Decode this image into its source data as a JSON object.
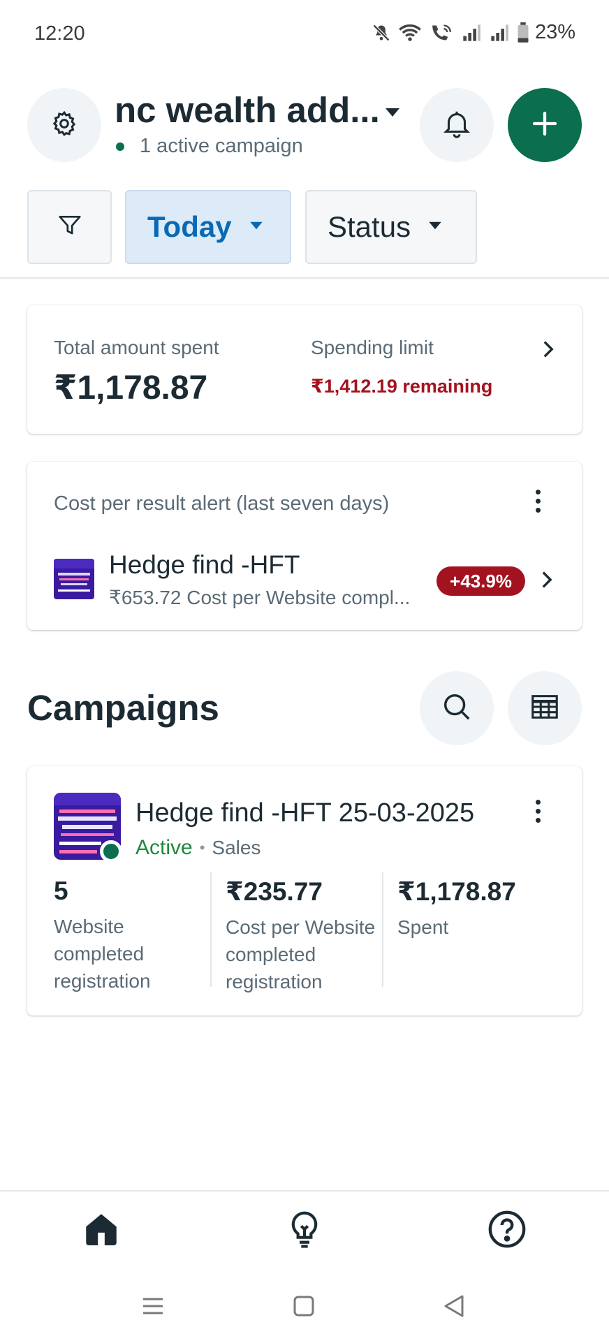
{
  "status_bar": {
    "time": "12:20",
    "battery": "23%",
    "icons": [
      "mute-icon",
      "wifi-icon",
      "wifi-call-icon",
      "signal-icon",
      "signal-icon",
      "battery-icon"
    ]
  },
  "header": {
    "account_name": "nc wealth add...",
    "active_campaigns": "1 active campaign",
    "icons": {
      "settings": "gear-icon",
      "notifications": "bell-icon",
      "create": "plus-icon"
    }
  },
  "filters": {
    "date_label": "Today",
    "status_label": "Status"
  },
  "spend_summary": {
    "total_label": "Total amount spent",
    "total_value": "₹1,178.87",
    "limit_label": "Spending limit",
    "limit_remaining": "₹1,412.19 remaining"
  },
  "alert": {
    "title": "Cost per result alert (last seven days)",
    "campaign_name": "Hedge find -HFT",
    "cost_line": "₹653.72  Cost per Website compl...",
    "change_badge": "+43.9%"
  },
  "campaigns": {
    "section_title": "Campaigns",
    "items": [
      {
        "name": "Hedge find -HFT 25-03-2025",
        "status": "Active",
        "objective": "Sales",
        "metrics": [
          {
            "value": "5",
            "label": "Website completed registration"
          },
          {
            "value": "₹235.77",
            "label": "Cost per Website completed registration"
          },
          {
            "value": "₹1,178.87",
            "label": "Spent"
          }
        ]
      }
    ]
  },
  "bottom_nav": {
    "items": [
      "home-icon",
      "lightbulb-icon",
      "help-icon"
    ]
  },
  "colors": {
    "brand_green": "#0a6e4f",
    "accent_blue": "#0a69b5",
    "alert_red": "#a3121f",
    "active_green": "#1e8a3a"
  }
}
